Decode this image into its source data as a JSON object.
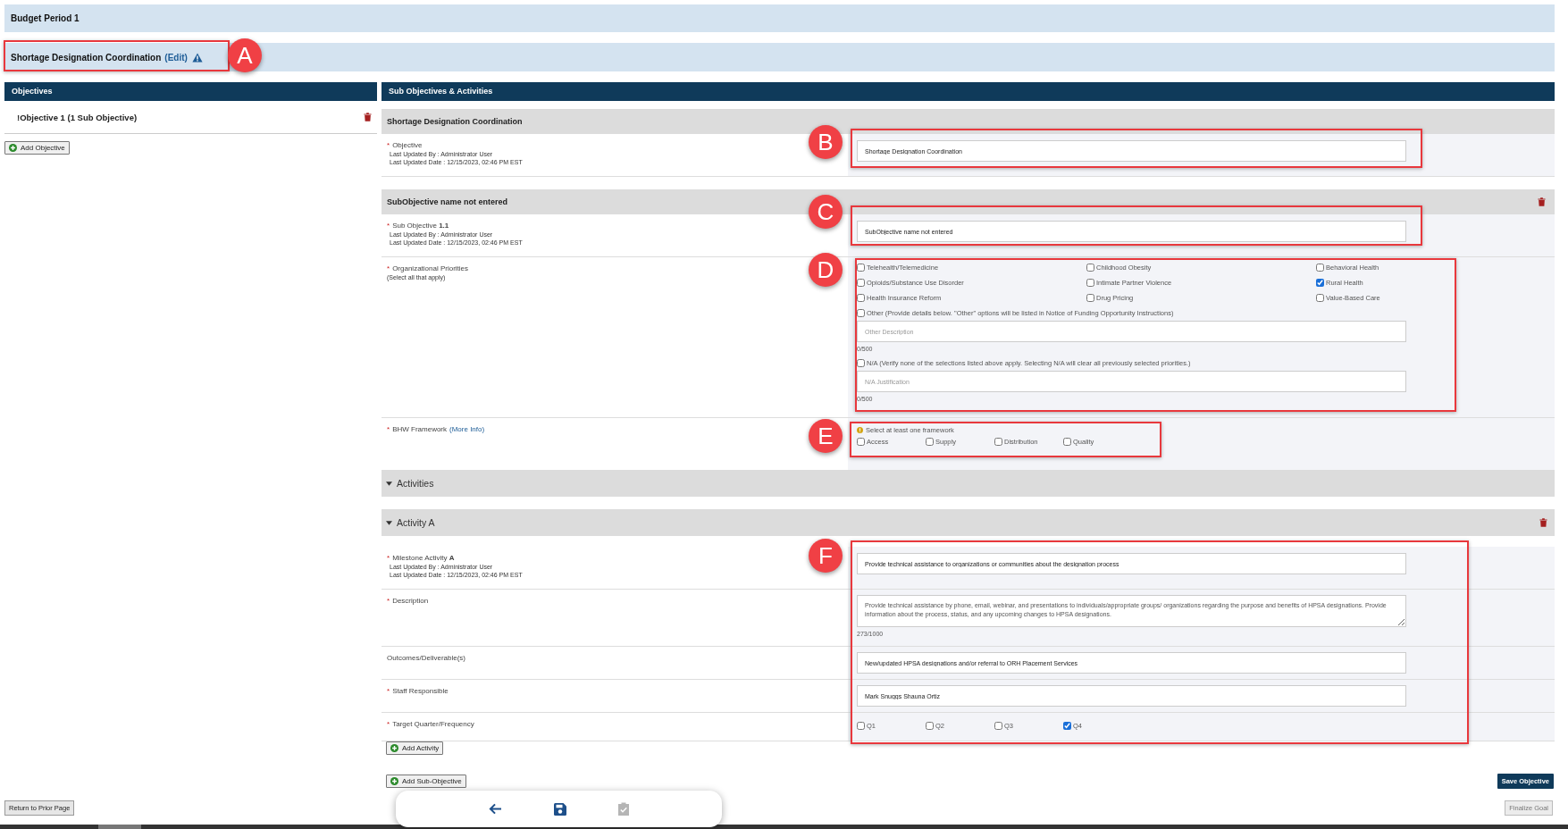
{
  "budget_period": "Budget Period 1",
  "goal": {
    "title": "Shortage Designation Coordination",
    "edit_link": "(Edit)"
  },
  "objectives_panel": {
    "header": "Objectives",
    "items": [
      {
        "flag": "!",
        "label": "Objective 1 (1 Sub Objective)"
      }
    ],
    "add_button": "Add Objective"
  },
  "sub_panel": {
    "header": "Sub Objectives & Activities",
    "objective": {
      "title": "Shortage Designation Coordination",
      "label": "Objective",
      "required": true,
      "updated_by": "Last Updated By : Administrator User",
      "updated_date": "Last Updated Date : 12/15/2023, 02:46 PM EST",
      "value": "Shortage Designation Coordination"
    },
    "sub_objective": {
      "title": "SubObjective name not entered",
      "label": "Sub Objective **1.1**",
      "required": true,
      "updated_by": "Last Updated By : Administrator User",
      "updated_date": "Last Updated Date : 12/15/2023, 02:46 PM EST",
      "value": "SubObjective name not entered"
    },
    "priorities": {
      "label": "Organizational Priorities",
      "required": true,
      "hint": "(Select all that apply)",
      "options": [
        {
          "label": "Telehealth/Telemedicine",
          "checked": false
        },
        {
          "label": "Childhood Obesity",
          "checked": false
        },
        {
          "label": "Behavioral Health",
          "checked": false
        },
        {
          "label": "Opioids/Substance Use Disorder",
          "checked": false
        },
        {
          "label": "Intimate Partner Violence",
          "checked": false
        },
        {
          "label": "Rural Health",
          "checked": true
        },
        {
          "label": "Health Insurance Reform",
          "checked": false
        },
        {
          "label": "Drug Pricing",
          "checked": false
        },
        {
          "label": "Value-Based Care",
          "checked": false
        }
      ],
      "extras": [
        {
          "label": "Other (Provide details below. \"Other\" options will be listed in Notice of Funding Opportunity Instructions)",
          "checked": false,
          "placeholder": "Other Description",
          "counter": "0/500"
        },
        {
          "label": "N/A (Verify none of the selections listed above apply. Selecting N/A will clear all previously selected priorities.)",
          "checked": false,
          "placeholder": "N/A Justification",
          "counter": "0/500"
        }
      ]
    },
    "framework": {
      "label": "BHW Framework",
      "required": true,
      "link": "(More Info)",
      "warning": "Select at least one framework",
      "options": [
        {
          "label": "Access",
          "checked": false
        },
        {
          "label": "Supply",
          "checked": false
        },
        {
          "label": "Distribution",
          "checked": false
        },
        {
          "label": "Quality",
          "checked": false
        }
      ]
    },
    "activities": {
      "title": "Activities",
      "expanded": true
    },
    "activity": {
      "title": "Activity A",
      "expanded": true,
      "milestone": {
        "label": "Milestone Activity **A**",
        "required": true,
        "updated_by": "Last Updated By : Administrator User",
        "updated_date": "Last Updated Date : 12/15/2023, 02:46 PM EST",
        "value": "Provide technical assistance to organizations or communities about the designation process"
      },
      "description": {
        "label": "Description",
        "required": true,
        "value": "Provide technical assistance by phone, email, webinar, and presentations to individuals/appropriate groups/ organizations regarding the purpose and benefits of HPSA designations. Provide information about the process, status, and any upcoming changes to HPSA designations.",
        "counter": "273/1000"
      },
      "outcomes": {
        "label": "Outcomes/Deliverable(s)",
        "required": false,
        "value": "New/updated HPSA designations and/or referral to ORH Placement Services"
      },
      "staff": {
        "label": "Staff Responsible",
        "required": true,
        "value": "Mark Snuggs Shauna Ortiz"
      },
      "target": {
        "label": "Target Quarter/Frequency",
        "required": true,
        "options": [
          {
            "label": "Q1",
            "checked": false
          },
          {
            "label": "Q2",
            "checked": false
          },
          {
            "label": "Q3",
            "checked": false
          },
          {
            "label": "Q4",
            "checked": true
          }
        ]
      }
    },
    "add_activity": "Add Activity",
    "add_sub_objective": "Add Sub-Objective",
    "save_button": "Save Objective"
  },
  "return_button": "Return to Prior Page",
  "finalize_button": {
    "label": "Finalize Goal",
    "disabled": true
  },
  "toolbar": [
    {
      "kind": "back",
      "disabled": false
    },
    {
      "kind": "save",
      "disabled": false
    },
    {
      "kind": "submit",
      "disabled": true
    }
  ],
  "callouts": [
    "A",
    "B",
    "C",
    "D",
    "E",
    "F"
  ],
  "required_mark": "*"
}
